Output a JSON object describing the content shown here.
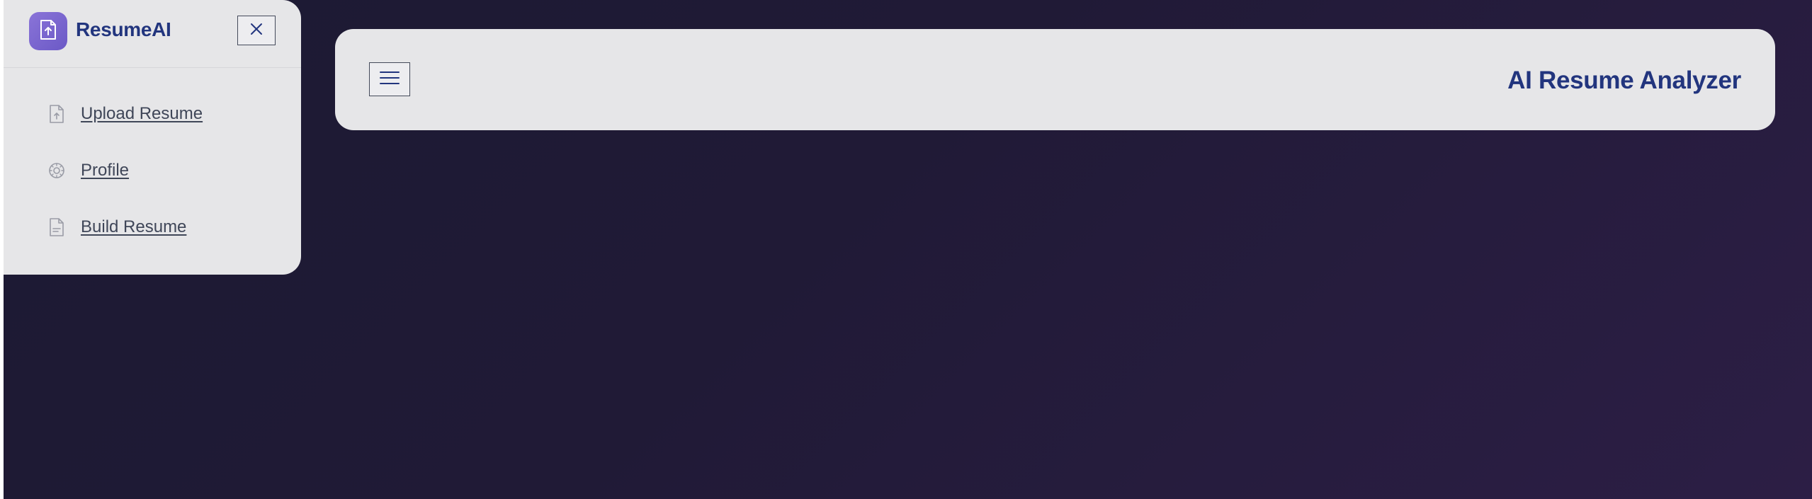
{
  "sidebar": {
    "brand": "ResumeAI",
    "logo_icon": "file-upload-icon",
    "close_icon": "close-icon",
    "items": [
      {
        "label": "Upload Resume",
        "icon": "file-upload-icon"
      },
      {
        "label": "Profile",
        "icon": "gear-icon"
      },
      {
        "label": "Build Resume",
        "icon": "file-text-icon"
      }
    ]
  },
  "header": {
    "title": "AI Resume Analyzer",
    "menu_icon": "hamburger-menu-icon"
  },
  "colors": {
    "brand_text": "#22357e",
    "accent_gradient_start": "#8a74d8",
    "accent_gradient_end": "#6b59c6",
    "panel_bg": "#e6e6e8",
    "page_bg": "#1f1b35"
  }
}
